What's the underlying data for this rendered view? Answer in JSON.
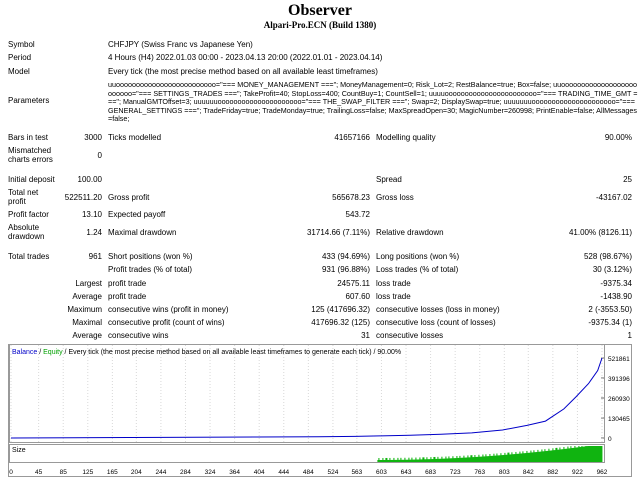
{
  "header": {
    "title": "Observer",
    "subtitle": "Alpari-Pro.ECN (Build 1380)"
  },
  "info": {
    "symbol_label": "Symbol",
    "symbol_value": "CHFJPY (Swiss Franc vs Japanese Yen)",
    "period_label": "Period",
    "period_value": "4 Hours (H4) 2022.01.03 00:00 - 2023.04.13 20:00 (2022.01.01 - 2023.04.14)",
    "model_label": "Model",
    "model_value": "Every tick (the most precise method based on all available least timeframes)",
    "parameters_label": "Parameters",
    "parameters_value": "uuooooooooooooooooooooooooo=\"=== MONEY_MANAGEMENT ===\"; MoneyManagement=0; Risk_Lot=2; RestBalance=true; Box=false; uuooooooooooooooooooooooooo=\"=== SETTINGS_TRADES ===\"; TakeProfit=40; StopLoss=400; CountBuy=1; CountSell=1; uuuuooooooooooooooooooooooo=\"=== TRADING_TIME_GMT ===\"; ManualGMTOffset=3; uuuuuuooooooooooooooooooooo=\"=== THE_SWAP_FILTER ===\"; Swap=2; DisplaySwap=true; uuuuuuuooooooooooooooooooooo=\"=== GENERAL_SETTINGS ===\"; TradeFriday=true; TradeMonday=true; TrailingLoss=false; MaxSpreadOpen=30; MagicNumber=260998; PrintEnable=false; AllMessages=false;"
  },
  "stats": {
    "bars_label": "Bars in test",
    "bars_value": "3000",
    "ticks_label": "Ticks modelled",
    "ticks_value": "41657166",
    "mq_label": "Modelling quality",
    "mq_value": "90.00%",
    "mismatch_label": "Mismatched charts errors",
    "mismatch_value": "0",
    "deposit_label": "Initial deposit",
    "deposit_value": "100.00",
    "spread_label": "Spread",
    "spread_value": "25",
    "netprofit_label": "Total net profit",
    "netprofit_value": "522511.20",
    "grossprofit_label": "Gross profit",
    "grossprofit_value": "565678.23",
    "grossloss_label": "Gross loss",
    "grossloss_value": "-43167.02",
    "pf_label": "Profit factor",
    "pf_value": "13.10",
    "ep_label": "Expected payoff",
    "ep_value": "543.72",
    "absdd_label": "Absolute drawdown",
    "absdd_value": "1.24",
    "maxdd_label": "Maximal drawdown",
    "maxdd_value": "31714.66 (7.11%)",
    "reldd_label": "Relative drawdown",
    "reldd_value": "41.00% (8126.11)",
    "tt_label": "Total trades",
    "tt_value": "961",
    "short_label": "Short positions (won %)",
    "short_value": "433 (94.69%)",
    "long_label": "Long positions (won %)",
    "long_value": "528 (98.67%)",
    "ptrades_label": "Profit trades (% of total)",
    "ptrades_value": "931 (96.88%)",
    "ltrades_label": "Loss trades (% of total)",
    "ltrades_value": "30 (3.12%)",
    "largest_label": "Largest",
    "lpt_label": "profit trade",
    "lpt_value": "24575.11",
    "llt_label": "loss trade",
    "llt_value": "-9375.34",
    "average_label": "Average",
    "apt_label": "profit trade",
    "apt_value": "607.60",
    "alt_label": "loss trade",
    "alt_value": "-1438.90",
    "maximum_label": "Maximum",
    "mcw_label": "consecutive wins (profit in money)",
    "mcw_value": "125 (417696.32)",
    "mcl_label": "consecutive losses (loss in money)",
    "mcl_value": "2 (-3553.50)",
    "maximal_label": "Maximal",
    "mcp_label": "consecutive profit (count of wins)",
    "mcp_value": "417696.32 (125)",
    "mcloss_label": "consecutive loss (count of losses)",
    "mcloss_value": "-9375.34 (1)",
    "average2_label": "Average",
    "acw_label": "consecutive wins",
    "acw_value": "31",
    "acl_label": "consecutive losses",
    "acl_value": "1"
  },
  "chart_legend": {
    "balance": "Balance",
    "sep": " / ",
    "equity": "Equity",
    "rest": " / Every tick (the most precise method based on all available least timeframes to generate each tick) / 90.00%"
  },
  "colors": {
    "balance": "#0000c8",
    "equity": "#00a000",
    "size": "#00b000"
  },
  "chart_data": {
    "type": "line",
    "title": "",
    "x_ticks": [
      "0",
      "45",
      "85",
      "125",
      "165",
      "204",
      "244",
      "284",
      "324",
      "364",
      "404",
      "444",
      "484",
      "524",
      "563",
      "603",
      "643",
      "683",
      "723",
      "763",
      "803",
      "842",
      "882",
      "922",
      "962"
    ],
    "y_ticks": [
      "521861",
      "391396",
      "260930",
      "130465",
      "0"
    ],
    "size_label": "Size",
    "ylim": [
      0,
      521861
    ],
    "xlim": [
      0,
      962
    ],
    "series": [
      {
        "name": "Balance",
        "x": [
          0,
          100,
          200,
          300,
          400,
          500,
          560,
          600,
          650,
          700,
          750,
          800,
          840,
          870,
          900,
          920,
          940,
          955,
          962
        ],
        "values": [
          100,
          1800,
          3200,
          4600,
          6200,
          8200,
          10500,
          13500,
          18000,
          24000,
          33000,
          52000,
          82000,
          110000,
          190000,
          270000,
          355000,
          440000,
          521861
        ]
      }
    ],
    "size_start_fraction": 0.62
  },
  "chart_axes": {
    "x_ticks_bind": true
  }
}
